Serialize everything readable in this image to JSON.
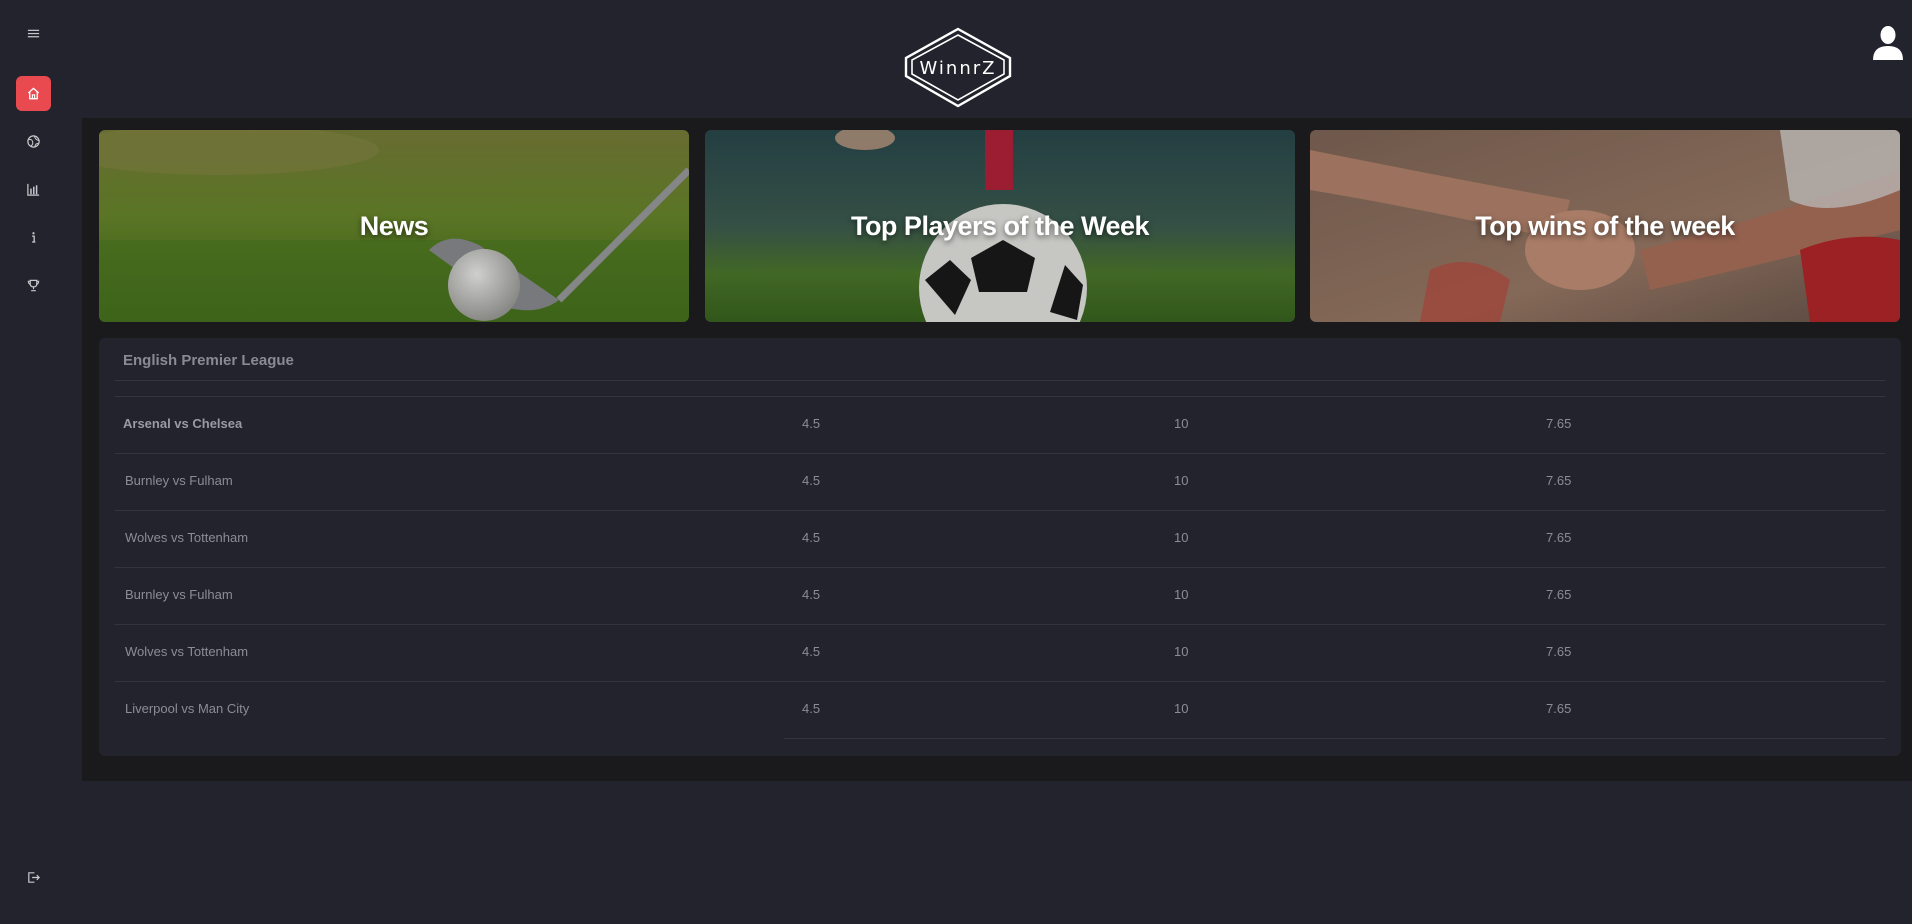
{
  "brand": {
    "logo_text": "WinnrZ"
  },
  "sidebar": {
    "items": [
      {
        "name": "menu",
        "icon": "hamburger-menu-icon"
      },
      {
        "name": "home",
        "icon": "home-icon",
        "active": true
      },
      {
        "name": "world",
        "icon": "globe-icon"
      },
      {
        "name": "stats",
        "icon": "bar-chart-icon"
      },
      {
        "name": "info",
        "icon": "info-icon"
      },
      {
        "name": "trophy",
        "icon": "trophy-icon"
      },
      {
        "name": "logout",
        "icon": "logout-icon"
      }
    ]
  },
  "cards": [
    {
      "title": "News"
    },
    {
      "title": "Top Players of the Week"
    },
    {
      "title": "Top wins of the week"
    }
  ],
  "league": {
    "title": "English Premier League",
    "matches": [
      {
        "match": "Arsenal vs Chelsea",
        "odds": [
          "4.5",
          "10",
          "7.65"
        ]
      },
      {
        "match": "Burnley vs Fulham",
        "odds": [
          "4.5",
          "10",
          "7.65"
        ]
      },
      {
        "match": "Wolves vs Tottenham",
        "odds": [
          "4.5",
          "10",
          "7.65"
        ]
      },
      {
        "match": "Burnley vs Fulham",
        "odds": [
          "4.5",
          "10",
          "7.65"
        ]
      },
      {
        "match": "Wolves vs Tottenham",
        "odds": [
          "4.5",
          "10",
          "7.65"
        ]
      },
      {
        "match": "Liverpool vs Man City",
        "odds": [
          "4.5",
          "10",
          "7.65"
        ]
      }
    ]
  },
  "colors": {
    "accent": "#e84a50",
    "background": "#23232d",
    "panel": "#1a1a1c"
  }
}
